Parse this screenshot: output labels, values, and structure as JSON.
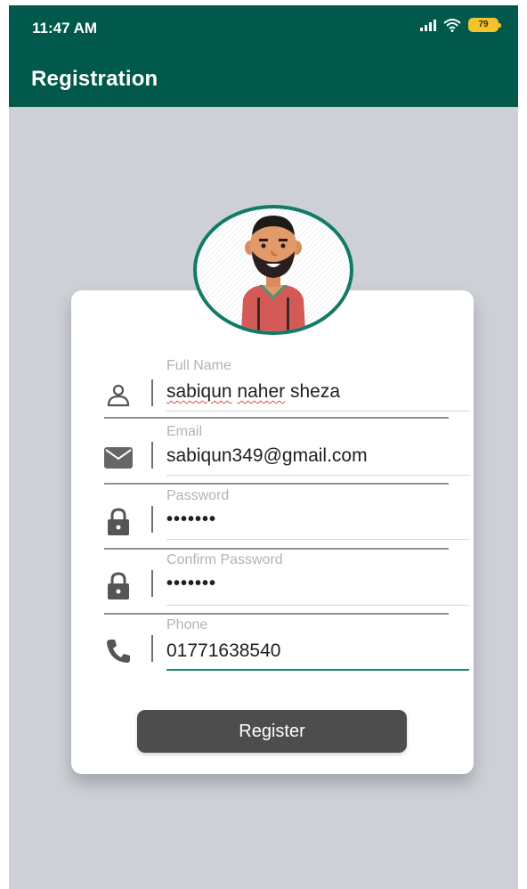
{
  "status_bar": {
    "time": "11:47 AM",
    "battery": "79",
    "icons": [
      "signal-icon",
      "wifi-icon",
      "battery-icon"
    ]
  },
  "app_bar": {
    "title": "Registration"
  },
  "avatar": {
    "icon": "user-avatar-illustration"
  },
  "form": {
    "full_name": {
      "label": "Full Name",
      "value_words": [
        "sabiqun",
        "naher",
        "sheza"
      ],
      "icon": "person-icon"
    },
    "email": {
      "label": "Email",
      "value": "sabiqun349@gmail.com",
      "icon": "mail-icon"
    },
    "password": {
      "label": "Password",
      "value": "•••••••",
      "icon": "lock-icon"
    },
    "confirm_password": {
      "label": "Confirm Password",
      "value": "•••••••",
      "icon": "lock-icon"
    },
    "phone": {
      "label": "Phone",
      "value": "01771638540",
      "icon": "phone-icon"
    }
  },
  "register_button": {
    "label": "Register"
  },
  "colors": {
    "primary": "#00594b",
    "accent": "#1a8a76",
    "background": "#cdd1d6",
    "button": "#4d4d4d",
    "battery": "#f4c22b"
  }
}
